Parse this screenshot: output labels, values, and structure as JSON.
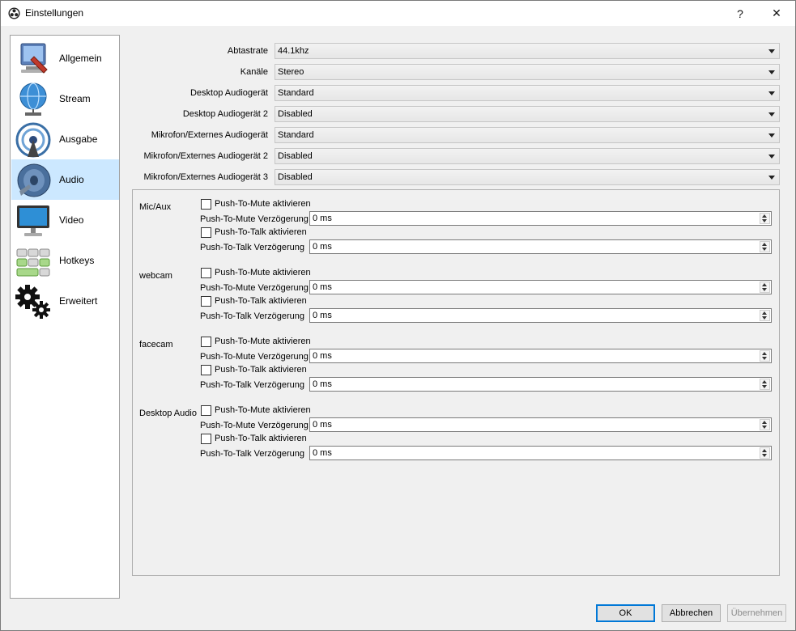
{
  "window": {
    "title": "Einstellungen",
    "help_glyph": "?",
    "close_glyph": "✕"
  },
  "sidebar": {
    "items": [
      {
        "label": "Allgemein",
        "icon": "general-settings-icon"
      },
      {
        "label": "Stream",
        "icon": "stream-globe-icon"
      },
      {
        "label": "Ausgabe",
        "icon": "output-broadcast-icon"
      },
      {
        "label": "Audio",
        "icon": "audio-speaker-icon",
        "selected": true
      },
      {
        "label": "Video",
        "icon": "video-monitor-icon"
      },
      {
        "label": "Hotkeys",
        "icon": "hotkeys-keyboard-icon"
      },
      {
        "label": "Erweitert",
        "icon": "advanced-gears-icon"
      }
    ]
  },
  "audio": {
    "fields": [
      {
        "label": "Abtastrate",
        "value": "44.1khz"
      },
      {
        "label": "Kanäle",
        "value": "Stereo"
      },
      {
        "label": "Desktop Audiogerät",
        "value": "Standard"
      },
      {
        "label": "Desktop Audiogerät 2",
        "value": "Disabled"
      },
      {
        "label": "Mikrofon/Externes Audiogerät",
        "value": "Standard"
      },
      {
        "label": "Mikrofon/Externes Audiogerät 2",
        "value": "Disabled"
      },
      {
        "label": "Mikrofon/Externes Audiogerät 3",
        "value": "Disabled"
      }
    ],
    "devices": [
      {
        "name": "Mic/Aux",
        "ptm_label": "Push-To-Mute aktivieren",
        "ptm_delay_label": "Push-To-Mute Verzögerung",
        "ptm_delay": "0 ms",
        "ptt_label": "Push-To-Talk aktivieren",
        "ptt_delay_label": "Push-To-Talk Verzögerung",
        "ptt_delay": "0 ms"
      },
      {
        "name": "webcam",
        "ptm_label": "Push-To-Mute aktivieren",
        "ptm_delay_label": "Push-To-Mute Verzögerung",
        "ptm_delay": "0 ms",
        "ptt_label": "Push-To-Talk aktivieren",
        "ptt_delay_label": "Push-To-Talk Verzögerung",
        "ptt_delay": "0 ms"
      },
      {
        "name": "facecam",
        "ptm_label": "Push-To-Mute aktivieren",
        "ptm_delay_label": "Push-To-Mute Verzögerung",
        "ptm_delay": "0 ms",
        "ptt_label": "Push-To-Talk aktivieren",
        "ptt_delay_label": "Push-To-Talk Verzögerung",
        "ptt_delay": "0 ms"
      },
      {
        "name": "Desktop Audio",
        "ptm_label": "Push-To-Mute aktivieren",
        "ptm_delay_label": "Push-To-Mute Verzögerung",
        "ptm_delay": "0 ms",
        "ptt_label": "Push-To-Talk aktivieren",
        "ptt_delay_label": "Push-To-Talk Verzögerung",
        "ptt_delay": "0 ms"
      }
    ]
  },
  "buttons": {
    "ok": "OK",
    "cancel": "Abbrechen",
    "apply": "Übernehmen"
  },
  "colors": {
    "selection": "#cce8ff",
    "default_button_border": "#0078d7"
  }
}
